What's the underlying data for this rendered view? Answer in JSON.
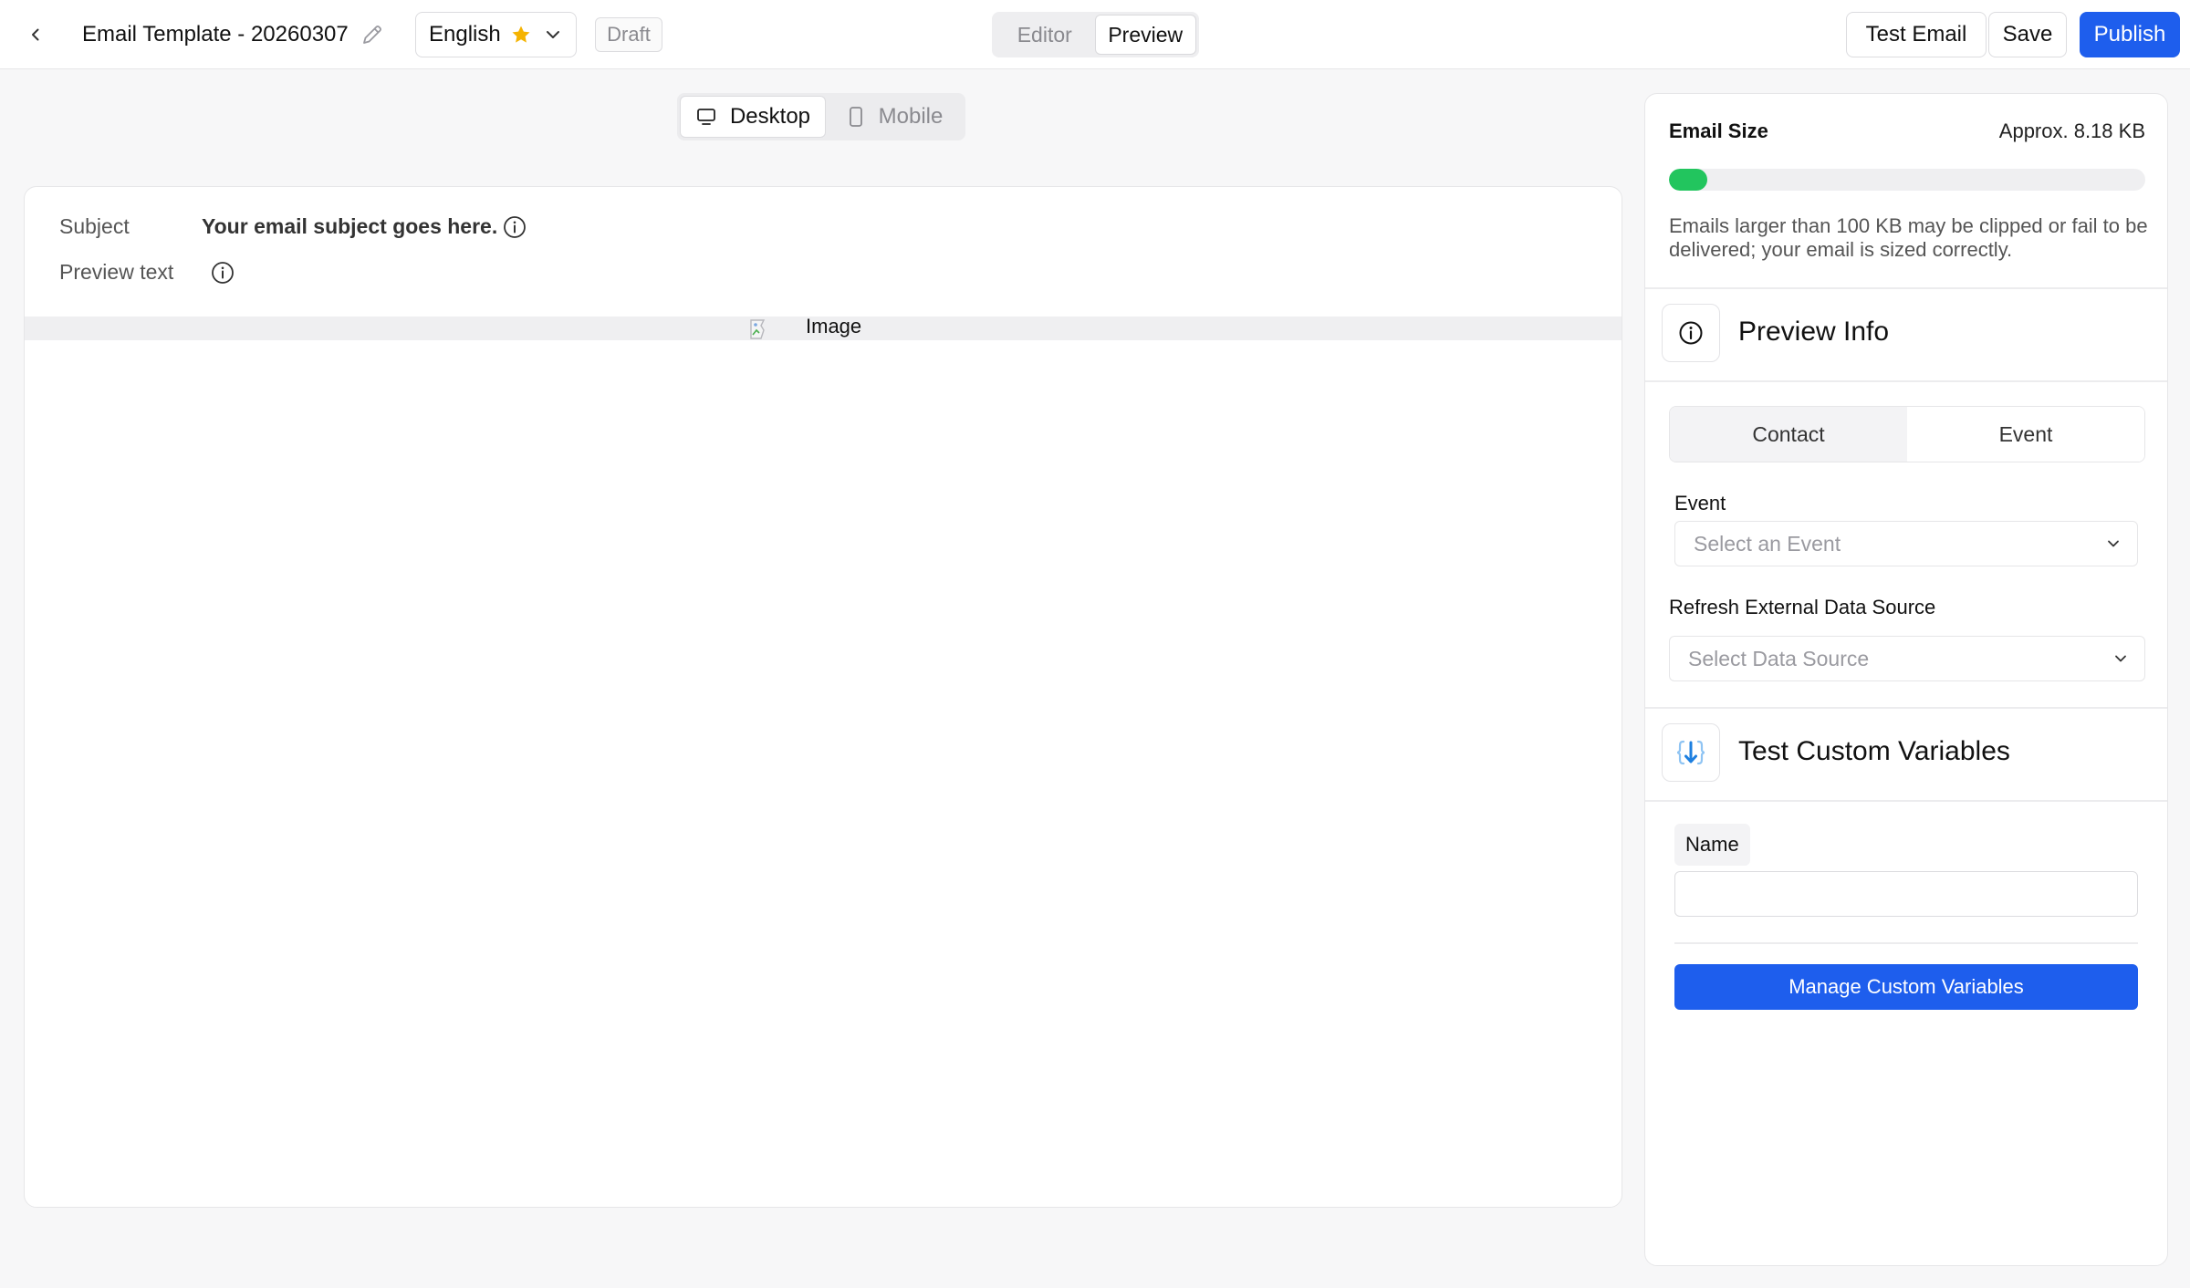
{
  "topbar": {
    "back_icon": "chevron-left-icon",
    "template_title": "Email Template - 20260307",
    "edit_icon": "pencil-icon",
    "language": {
      "selected": "English",
      "default_icon": "star-icon",
      "star_color": "#f5b301"
    },
    "status_badge": "Draft",
    "mode_tabs": {
      "items": [
        "Editor",
        "Preview"
      ],
      "active": "Preview"
    },
    "buttons": {
      "test_email": "Test Email",
      "save": "Save",
      "publish": "Publish"
    },
    "accent_color": "#1e5eed"
  },
  "device_toggle": {
    "items": [
      {
        "label": "Desktop",
        "icon": "monitor-icon",
        "active": true
      },
      {
        "label": "Mobile",
        "icon": "smartphone-icon",
        "active": false
      }
    ]
  },
  "preview": {
    "subject_label": "Subject",
    "subject_value": "Your email subject goes here.",
    "preview_text_label": "Preview text",
    "preview_text_value": "",
    "image_alt": "Image",
    "info_icon": "info-icon"
  },
  "side_panel": {
    "email_size": {
      "title": "Email Size",
      "value": "Approx. 8.18 KB",
      "fill_fraction": 0.08,
      "fill_color": "#22c55e",
      "note": "Emails larger than 100 KB may be clipped or fail to be delivered; your email is sized correctly."
    },
    "preview_info": {
      "title": "Preview Info",
      "icon": "info-icon",
      "tabs": [
        "Contact",
        "Event"
      ],
      "event_label": "Event",
      "event_placeholder": "Select an Event",
      "refresh_label": "Refresh External Data Source",
      "data_source_placeholder": "Select Data Source"
    },
    "custom_vars": {
      "title": "Test Custom Variables",
      "icon": "braces-arrow-icon",
      "name_label": "Name",
      "name_value": "",
      "manage_button": "Manage Custom Variables"
    }
  }
}
